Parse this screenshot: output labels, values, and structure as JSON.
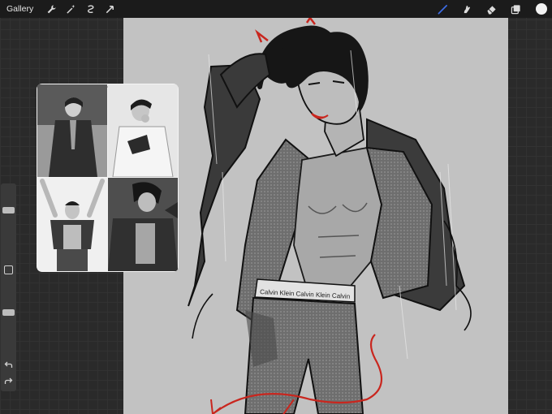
{
  "toolbar": {
    "gallery_label": "Gallery",
    "left_tools": [
      "wrench-icon",
      "magic-wand-icon",
      "selection-icon",
      "transform-arrow-icon"
    ],
    "right_tools": [
      "brush-icon",
      "smudge-icon",
      "eraser-icon",
      "layers-icon"
    ],
    "active_tool": "brush-icon",
    "brush_color": "#3d6ee8",
    "current_color": "#f2f2f2"
  },
  "sidebar": {
    "brush_size": 0.72,
    "opacity": 0.58,
    "icons": [
      "modify-square-icon",
      "undo-icon",
      "redo-icon"
    ]
  },
  "artwork": {
    "waistband_text": "Calvin Klein   Calvin Klein   Calvin",
    "accent_color": "#c9261e"
  },
  "reference": {
    "photos": [
      "reference-photo-1",
      "reference-photo-2",
      "reference-photo-3",
      "reference-photo-4"
    ]
  }
}
